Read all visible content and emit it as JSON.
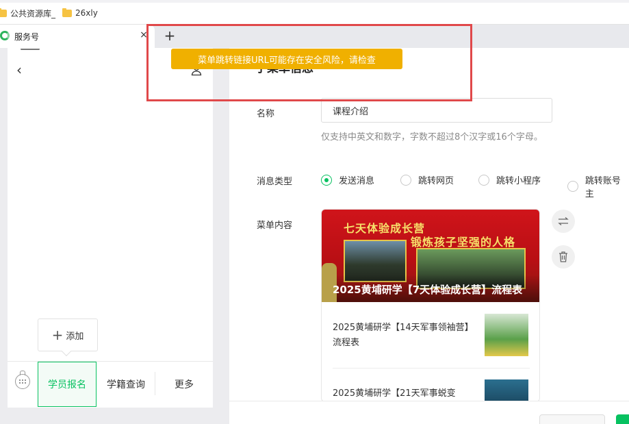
{
  "bookmarks": [
    {
      "label": "公共资源库_",
      "icon": "folder-icon"
    },
    {
      "label": "26xly",
      "icon": "folder-icon"
    }
  ],
  "browser": {
    "tab_title": "服务号",
    "tab_close": "×",
    "new_tab": "+"
  },
  "phone": {
    "back_glyph": "‹",
    "add_label": "添加",
    "add_glyph": "+",
    "menu": [
      "学员报名",
      "学籍查询",
      "更多"
    ]
  },
  "form": {
    "section_title": "子菜单信息",
    "name_label": "名称",
    "name_value": "课程介绍",
    "name_hint": "仅支持中英文和数字，字数不超过8个汉字或16个字母。",
    "type_label": "消息类型",
    "types": [
      "发送消息",
      "跳转网页",
      "跳转小程序",
      "跳转账号主"
    ],
    "selected_type": "发送消息",
    "content_label": "菜单内容"
  },
  "article_card": {
    "cover_tag": "七天体验成长营",
    "cover_tag2": "锻炼孩子坚强的人格",
    "cover_title": "2025黄埔研学【7天体验成长营】流程表",
    "items": [
      {
        "title": "2025黄埔研学【14天军事领袖营】流程表"
      },
      {
        "title": "2025黄埔研学【21天军事蜕变"
      }
    ]
  },
  "toast": {
    "message": "菜单跳转链接URL可能存在安全风险，请检查"
  },
  "colors": {
    "accent": "#07c160",
    "toast": "#f0b000",
    "highlight": "#e0484a"
  }
}
